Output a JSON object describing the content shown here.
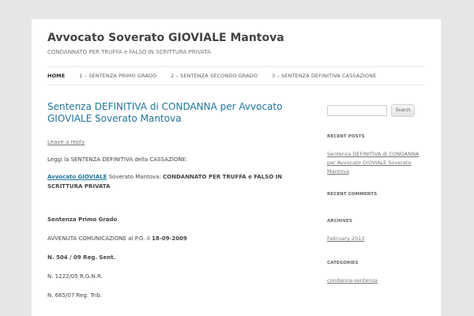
{
  "site": {
    "title": "Avvocato Soverato GIOVIALE Mantova",
    "description": "CONDANNATO PER TRUFFA e FALSO IN SCRITTURA PRIVATA"
  },
  "nav": {
    "items": [
      {
        "label": "HOME",
        "active": true
      },
      {
        "label": "1 – SENTENZA PRIMO GRADO"
      },
      {
        "label": "2 – SENTENZA SECONDO GRADO"
      },
      {
        "label": "3 – SENTENZA DEFINITIVA CASSAZIONE"
      }
    ]
  },
  "post": {
    "title": "Sentenza DEFINITIVA di CONDANNA per Avvocato GIOVIALE Soverato Mantova",
    "leave_reply": "Leave a reply",
    "intro": "Leggi la SENTENZA DEFINITIVA della CASSAZIONE:",
    "lawyer_link": "Avvocato GIOVIALE",
    "lawyer_rest": " Soverato Mantova: ",
    "lawyer_bold": "CONDANNATO PER TRUFFA e FALSO IN SCRITTURA PRIVATA",
    "primo_grado": "Sentenza Primo Grado",
    "comunicazione_text": "AVVENUTA COMUNICAZIONE al P.G. il ",
    "comunicazione_date": "18-09-2009",
    "reg_sent": "N. 504 / 09 Reg. Sent.",
    "rgnr": "N. 1222/05 R.G.N.R.",
    "reg_trib": "N. 665/07 Reg. Trib."
  },
  "sidebar": {
    "search_placeholder": "",
    "search_button": "Search",
    "recent_posts_title": "RECENT POSTS",
    "recent_post_link": "Sentenza DEFINITIVA di CONDANNA per Avvocato GIOVIALE Soverato Mantova",
    "recent_comments_title": "RECENT COMMENTS",
    "archives_title": "ARCHIVES",
    "archive_link": "February 2013",
    "categories_title": "CATEGORIES",
    "category_link": "condanna-sentenza"
  }
}
